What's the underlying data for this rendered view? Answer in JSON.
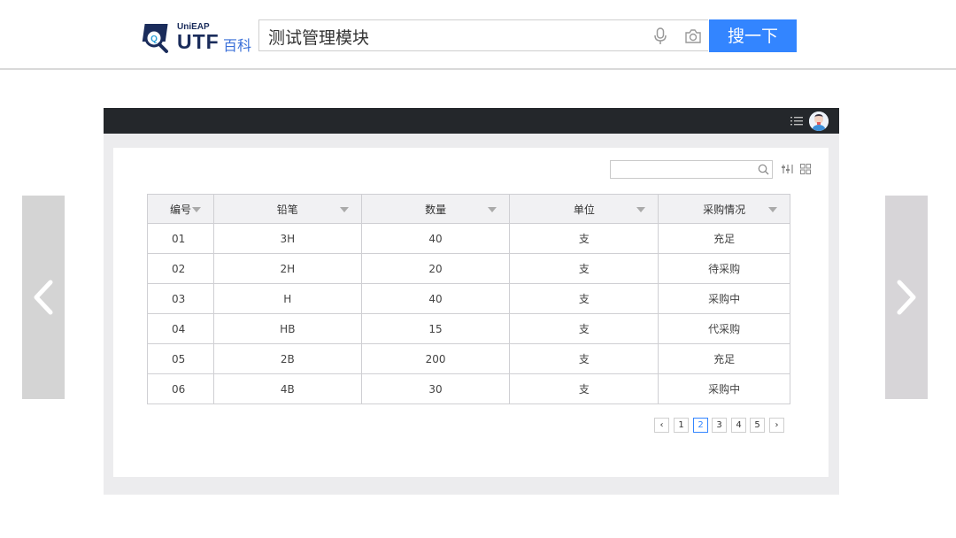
{
  "header": {
    "logo_top": "UniEAP",
    "logo_main": "UTF",
    "logo_cn": "百科",
    "search_value": "测试管理模块",
    "search_button": "搜一下"
  },
  "table": {
    "columns": [
      "编号",
      "铅笔",
      "数量",
      "单位",
      "采购情况"
    ],
    "rows": [
      [
        "01",
        "3H",
        "40",
        "支",
        "充足"
      ],
      [
        "02",
        "2H",
        "20",
        "支",
        "待采购"
      ],
      [
        "03",
        "H",
        "40",
        "支",
        "采购中"
      ],
      [
        "04",
        "HB",
        "15",
        "支",
        "代采购"
      ],
      [
        "05",
        "2B",
        "200",
        "支",
        "充足"
      ],
      [
        "06",
        "4B",
        "30",
        "支",
        "采购中"
      ]
    ]
  },
  "pager": {
    "prev": "‹",
    "pages": [
      "1",
      "2",
      "3",
      "4",
      "5"
    ],
    "current": "2",
    "next": "›"
  },
  "colors": {
    "accent": "#3385ff",
    "appbar": "#24272b"
  },
  "icons": [
    "voice-search-icon",
    "camera-search-icon",
    "menu-list-icon",
    "avatar-icon",
    "search-icon",
    "column-settings-icon",
    "grid-view-icon",
    "chevron-left-icon",
    "chevron-right-icon"
  ]
}
